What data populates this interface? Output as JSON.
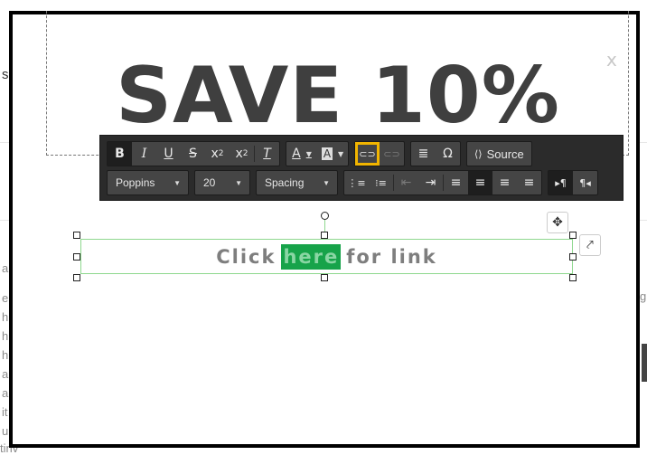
{
  "background_page": {
    "fragments": [
      "s",
      "a",
      "e",
      "h",
      "h",
      "h",
      "a",
      "a",
      "it",
      "u",
      "tinv",
      "g"
    ]
  },
  "popup": {
    "headline": "SAVE 10%",
    "close_glyph": "x"
  },
  "toolbar": {
    "bold": "B",
    "italic": "I",
    "underline": "U",
    "strike": "S",
    "subscript": "x",
    "superscript": "x",
    "clear_format": "T",
    "text_color": "A",
    "bg_color": "A",
    "link": "⊂⊃",
    "unlink": "⊂⊃",
    "hr": "≣",
    "special_char": "Ω",
    "source_label": "Source",
    "font_family": "Poppins",
    "font_size": "20",
    "spacing": "Spacing",
    "ordered_list": "⋮≡",
    "bullet_list": "⁝≡",
    "outdent": "⇤",
    "indent": "⇥",
    "align_left": "≡",
    "align_center": "≡",
    "align_right": "≡",
    "justify": "≡",
    "ltr": "▸¶",
    "rtl": "¶◂"
  },
  "text_element": {
    "before": "Click",
    "link_word": "here",
    "after": "for link"
  },
  "float_buttons": {
    "move_glyph": "✥",
    "share_glyph": "⤤"
  }
}
